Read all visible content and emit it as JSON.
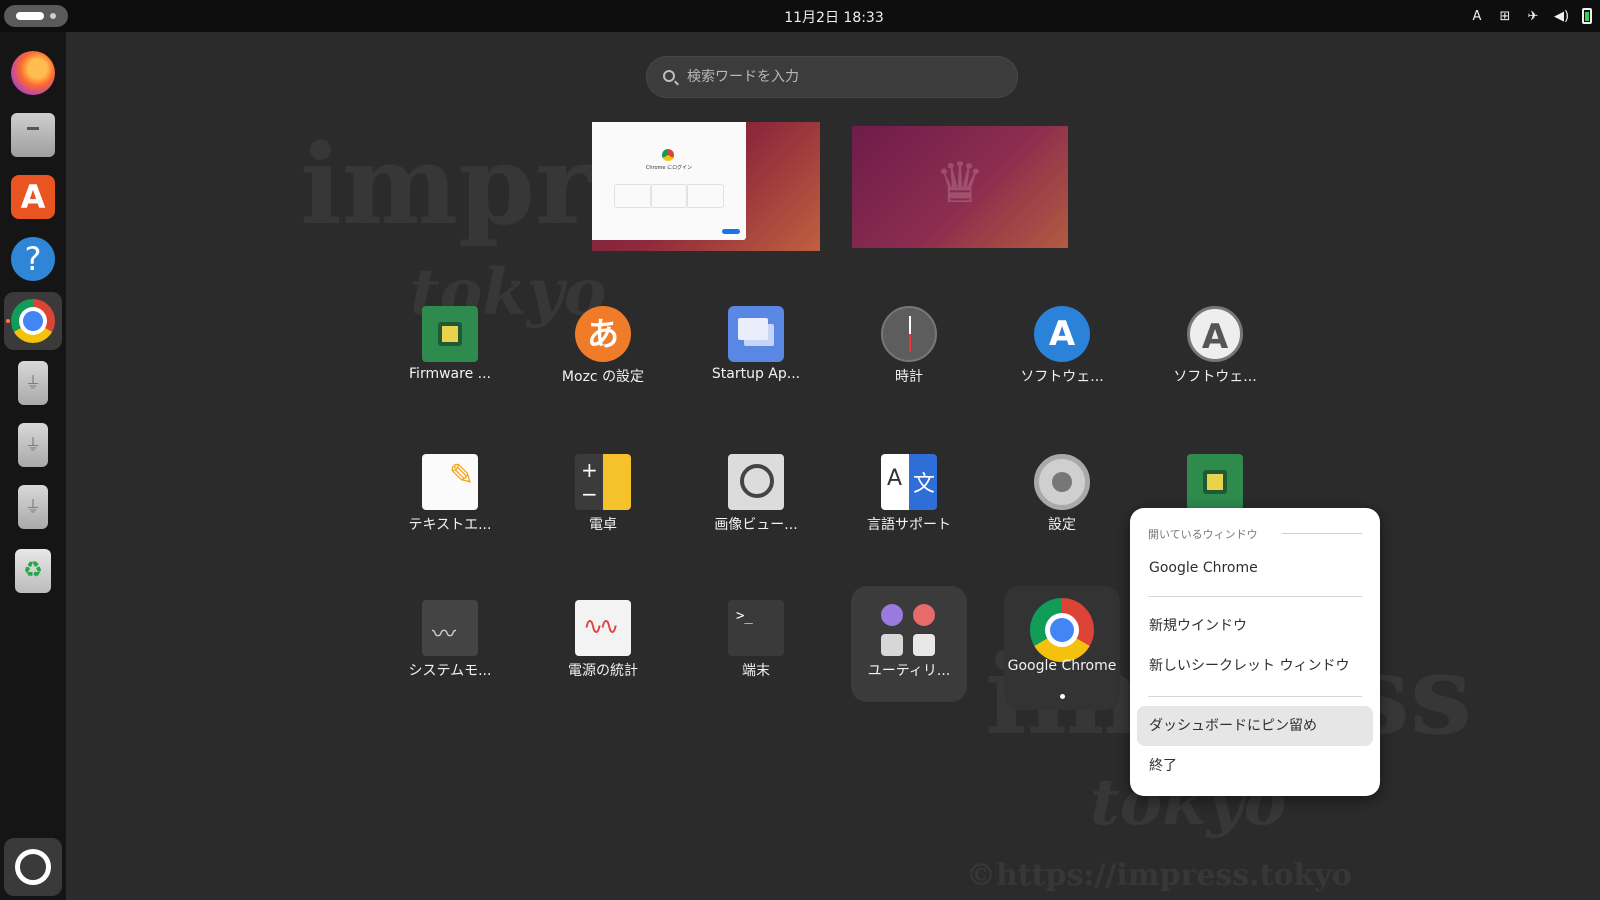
{
  "topbar": {
    "clock": "11月2日  18:33",
    "input_method": "A"
  },
  "dock": {
    "items": [
      "firefox",
      "files",
      "app-center",
      "help",
      "google-chrome",
      "usb-drive-1",
      "usb-drive-2",
      "usb-drive-3",
      "trash"
    ],
    "show_apps": "ubuntu"
  },
  "search": {
    "placeholder": "検索ワードを入力"
  },
  "watermark": {
    "line1": "impress",
    "line2": "tokyo",
    "url": "©https://impress.tokyo"
  },
  "workspaces": {
    "preview_window_title": "Chrome にログイン"
  },
  "apps": [
    {
      "label": "Firmware ..."
    },
    {
      "label": "Mozc の設定"
    },
    {
      "label": "Startup Ap..."
    },
    {
      "label": "時計"
    },
    {
      "label": "ソフトウェ..."
    },
    {
      "label": "ソフトウェ..."
    },
    {
      "label": "テキストエ..."
    },
    {
      "label": "電卓"
    },
    {
      "label": "画像ビュー..."
    },
    {
      "label": "言語サポート"
    },
    {
      "label": "設定"
    },
    {
      "label": ""
    },
    {
      "label": "システムモ..."
    },
    {
      "label": "電源の統計"
    },
    {
      "label": "端末"
    },
    {
      "label": "ユーティリ..."
    },
    {
      "label": "Google Chrome"
    }
  ],
  "context_menu": {
    "section_title": "開いているウィンドウ",
    "open_window": "Google Chrome",
    "new_window": "新規ウインドウ",
    "new_incognito": "新しいシークレット ウィンドウ",
    "pin_to_dash": "ダッシュボードにピン留め",
    "quit": "終了"
  }
}
